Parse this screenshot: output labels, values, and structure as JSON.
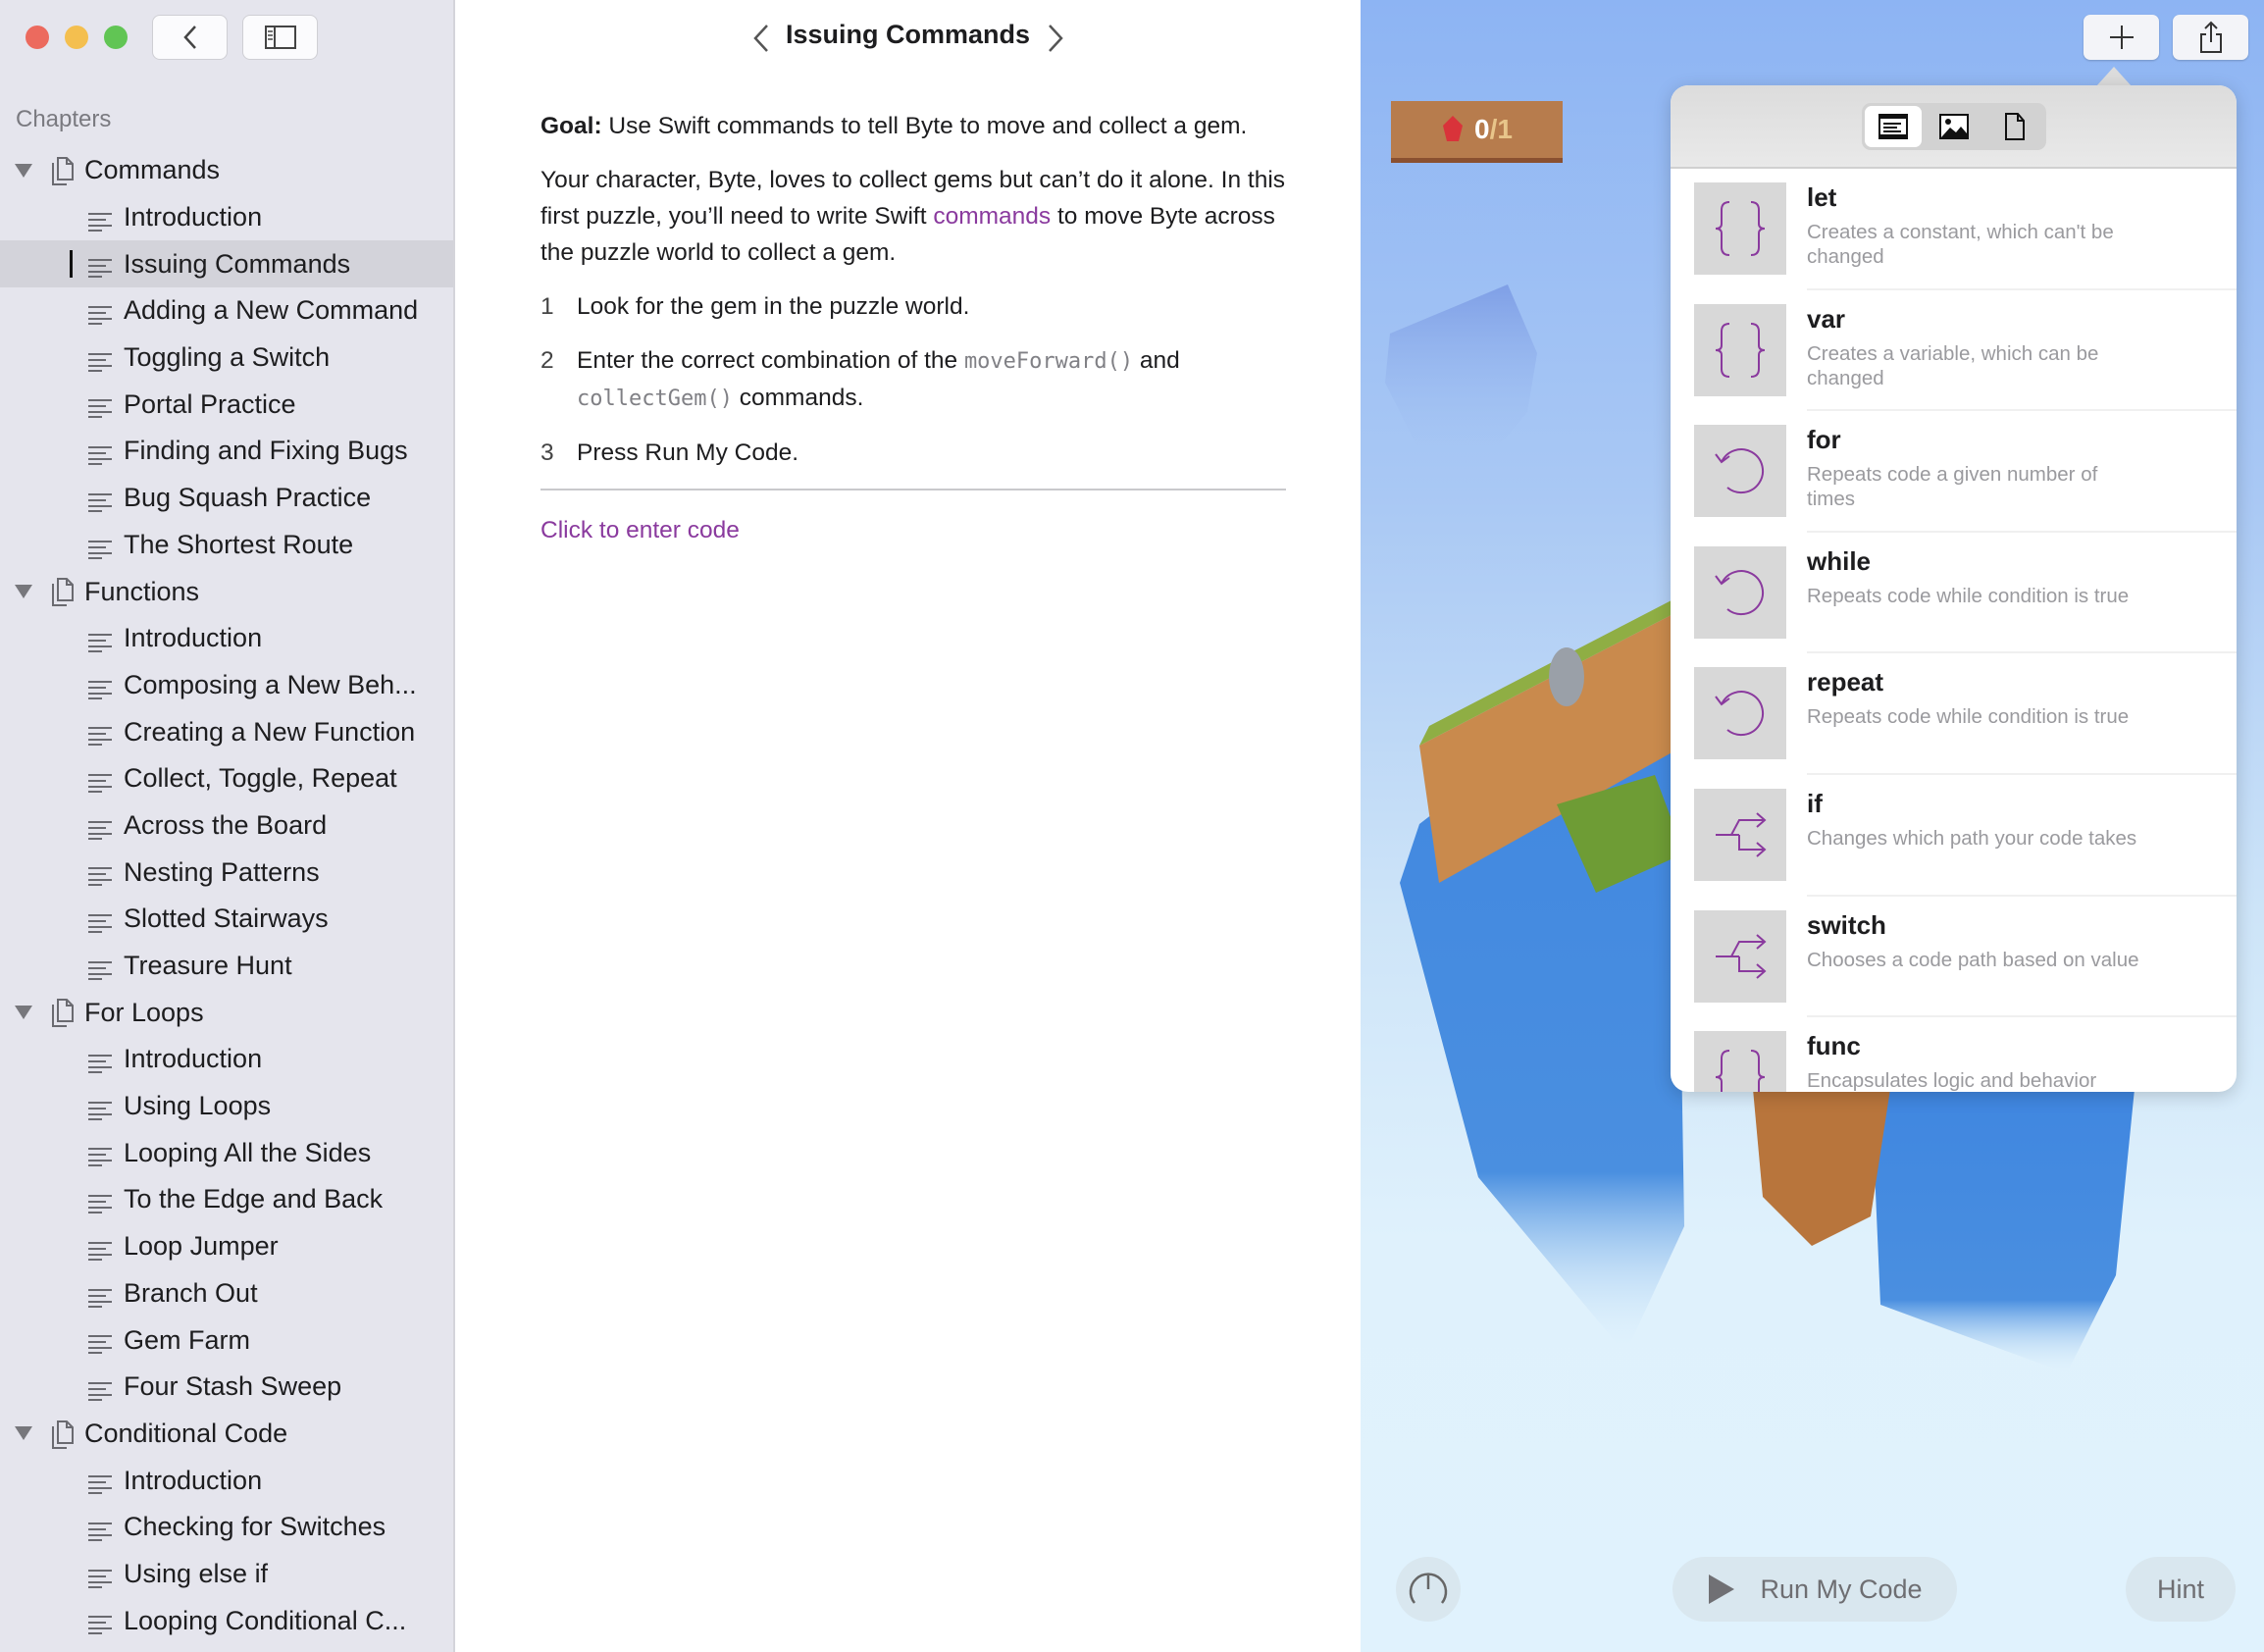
{
  "window": {
    "traffic_colors": [
      "#ec6a5e",
      "#f4bf4f",
      "#61c554"
    ]
  },
  "sidebar": {
    "section_label": "Chapters",
    "items": [
      {
        "type": "chapter",
        "label": "Commands"
      },
      {
        "type": "page",
        "label": "Introduction"
      },
      {
        "type": "page",
        "label": "Issuing Commands",
        "selected": true
      },
      {
        "type": "page",
        "label": "Adding a New Command"
      },
      {
        "type": "page",
        "label": "Toggling a Switch"
      },
      {
        "type": "page",
        "label": "Portal Practice"
      },
      {
        "type": "page",
        "label": "Finding and Fixing Bugs"
      },
      {
        "type": "page",
        "label": "Bug Squash Practice"
      },
      {
        "type": "page",
        "label": "The Shortest Route"
      },
      {
        "type": "chapter",
        "label": "Functions"
      },
      {
        "type": "page",
        "label": "Introduction"
      },
      {
        "type": "page",
        "label": "Composing a New Beh..."
      },
      {
        "type": "page",
        "label": "Creating a New Function"
      },
      {
        "type": "page",
        "label": "Collect, Toggle, Repeat"
      },
      {
        "type": "page",
        "label": "Across the Board"
      },
      {
        "type": "page",
        "label": "Nesting Patterns"
      },
      {
        "type": "page",
        "label": "Slotted Stairways"
      },
      {
        "type": "page",
        "label": "Treasure Hunt"
      },
      {
        "type": "chapter",
        "label": "For Loops"
      },
      {
        "type": "page",
        "label": "Introduction"
      },
      {
        "type": "page",
        "label": "Using Loops"
      },
      {
        "type": "page",
        "label": "Looping All the Sides"
      },
      {
        "type": "page",
        "label": "To the Edge and Back"
      },
      {
        "type": "page",
        "label": "Loop Jumper"
      },
      {
        "type": "page",
        "label": "Branch Out"
      },
      {
        "type": "page",
        "label": "Gem Farm"
      },
      {
        "type": "page",
        "label": "Four Stash Sweep"
      },
      {
        "type": "chapter",
        "label": "Conditional Code"
      },
      {
        "type": "page",
        "label": "Introduction"
      },
      {
        "type": "page",
        "label": "Checking for Switches"
      },
      {
        "type": "page",
        "label": "Using else if"
      },
      {
        "type": "page",
        "label": "Looping Conditional C..."
      }
    ]
  },
  "content": {
    "title": "Issuing Commands",
    "goal_label": "Goal:",
    "goal_text": " Use Swift commands to tell Byte to move and collect a gem.",
    "para_before": "Your character, Byte, loves to collect gems but can’t do it alone. In this first puzzle, you’ll need to write Swift ",
    "para_link": "commands",
    "para_after": " to move Byte across the puzzle world to collect a gem.",
    "step1_num": "1",
    "step1": "Look for the gem in the puzzle world.",
    "step2_num": "2",
    "step2_a": "Enter the correct combination of the ",
    "step2_code1": "moveForward()",
    "step2_b": " and ",
    "step2_code2": "collectGem()",
    "step2_c": " commands.",
    "step3_num": "3",
    "step3": "Press Run My Code.",
    "enter_code": "Click to enter code"
  },
  "scene": {
    "gem_count": "0",
    "gem_total": "/1",
    "run_label": "Run My Code",
    "hint_label": "Hint"
  },
  "popover": {
    "tabs": [
      "code-snippets",
      "images",
      "files"
    ],
    "active_tab": "code-snippets",
    "accent": "#8a3a9e",
    "items": [
      {
        "title": "let",
        "desc": "Creates a constant, which can't be changed",
        "icon": "braces"
      },
      {
        "title": "var",
        "desc": "Creates a variable, which can be changed",
        "icon": "braces"
      },
      {
        "title": "for",
        "desc": "Repeats code a given number of times",
        "icon": "loop"
      },
      {
        "title": "while",
        "desc": "Repeats code while condition is true",
        "icon": "loop"
      },
      {
        "title": "repeat",
        "desc": "Repeats code while condition is true",
        "icon": "loop"
      },
      {
        "title": "if",
        "desc": "Changes which path your code takes",
        "icon": "branch"
      },
      {
        "title": "switch",
        "desc": "Chooses a code path based on value",
        "icon": "branch"
      },
      {
        "title": "func",
        "desc": "Encapsulates logic and behavior",
        "icon": "braces"
      }
    ]
  }
}
